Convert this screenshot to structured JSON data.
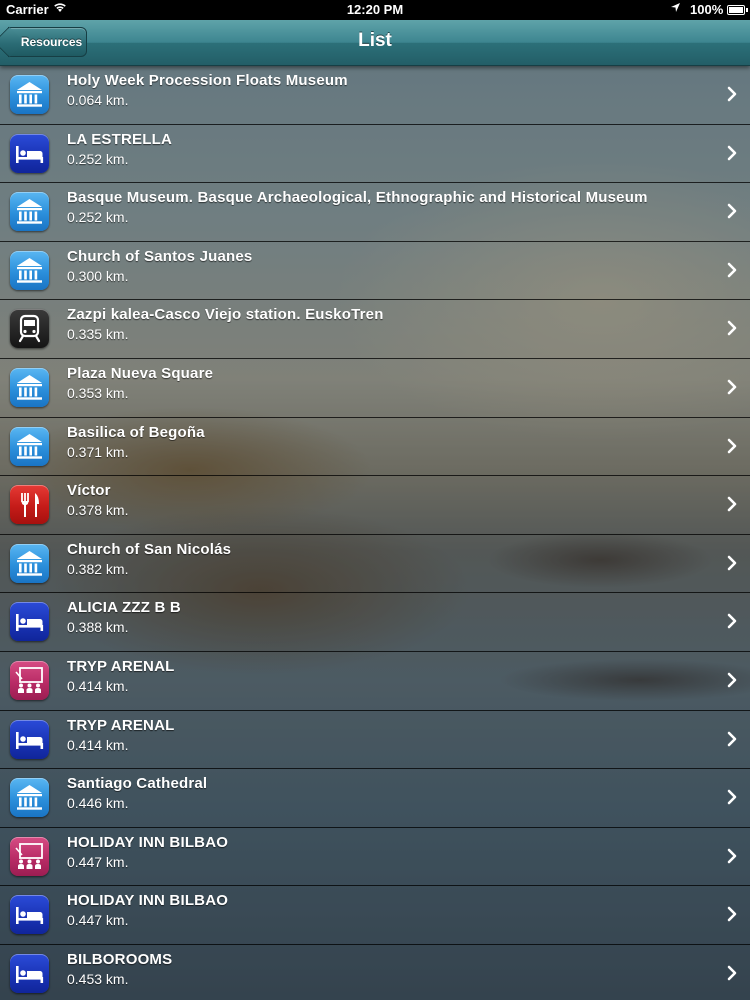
{
  "status_bar": {
    "carrier": "Carrier",
    "time": "12:20 PM",
    "battery": "100%"
  },
  "navbar": {
    "back_label": "Resources",
    "title": "List"
  },
  "colors": {
    "navbar": "#2c7079",
    "museum": "#2b8fdb",
    "hotel": "#1a34b6",
    "train": "#151515",
    "restaurant": "#c51c19",
    "meeting": "#b92c66"
  },
  "items": [
    {
      "icon": "museum",
      "title": "Holy Week Procession Floats Museum",
      "distance": "0.064 km."
    },
    {
      "icon": "hotel",
      "title": "LA ESTRELLA",
      "distance": "0.252 km."
    },
    {
      "icon": "museum",
      "title": "Basque Museum. Basque Archaeological, Ethnographic and Historical Museum",
      "distance": "0.252 km."
    },
    {
      "icon": "museum",
      "title": "Church of Santos Juanes",
      "distance": "0.300 km."
    },
    {
      "icon": "train",
      "title": "Zazpi kalea-Casco Viejo station. EuskoTren",
      "distance": "0.335 km."
    },
    {
      "icon": "museum",
      "title": "Plaza Nueva Square",
      "distance": "0.353 km."
    },
    {
      "icon": "museum",
      "title": "Basilica of Begoña",
      "distance": "0.371 km."
    },
    {
      "icon": "restaurant",
      "title": "Víctor",
      "distance": "0.378 km."
    },
    {
      "icon": "museum",
      "title": "Church of San Nicolás",
      "distance": "0.382 km."
    },
    {
      "icon": "hotel",
      "title": "ALICIA ZZZ B B",
      "distance": "0.388 km."
    },
    {
      "icon": "meeting",
      "title": "TRYP ARENAL",
      "distance": "0.414 km."
    },
    {
      "icon": "hotel",
      "title": "TRYP ARENAL",
      "distance": "0.414 km."
    },
    {
      "icon": "museum",
      "title": "Santiago Cathedral",
      "distance": "0.446 km."
    },
    {
      "icon": "meeting",
      "title": "HOLIDAY INN BILBAO",
      "distance": "0.447 km."
    },
    {
      "icon": "hotel",
      "title": "HOLIDAY INN BILBAO",
      "distance": "0.447 km."
    },
    {
      "icon": "hotel",
      "title": "BILBOROOMS",
      "distance": "0.453 km."
    }
  ]
}
